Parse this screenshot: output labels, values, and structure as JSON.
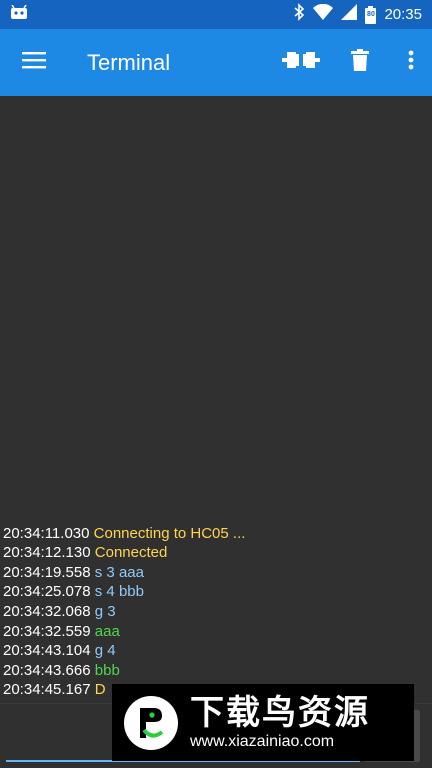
{
  "status_bar": {
    "time": "20:35",
    "battery_level": "80",
    "icons": [
      "android-icon",
      "bluetooth-icon",
      "wifi-icon",
      "cell-signal-icon",
      "battery-icon"
    ]
  },
  "app_bar": {
    "title": "Terminal",
    "actions": [
      "connect-icon",
      "delete-icon",
      "more-vert-icon"
    ]
  },
  "terminal": {
    "lines": [
      {
        "time": "20:34:11.030",
        "text": "Connecting to HC05 ...",
        "kind": "status"
      },
      {
        "time": "20:34:12.130",
        "text": "Connected",
        "kind": "status"
      },
      {
        "time": "20:34:19.558",
        "text": "s 3 aaa",
        "kind": "sent"
      },
      {
        "time": "20:34:25.078",
        "text": "s 4 bbb",
        "kind": "sent"
      },
      {
        "time": "20:34:32.068",
        "text": "g 3",
        "kind": "sent"
      },
      {
        "time": "20:34:32.559",
        "text": "aaa",
        "kind": "received"
      },
      {
        "time": "20:34:43.104",
        "text": "g 4",
        "kind": "sent"
      },
      {
        "time": "20:34:43.666",
        "text": "bbb",
        "kind": "received"
      },
      {
        "time": "20:34:45.167",
        "text": "D",
        "kind": "status"
      }
    ]
  },
  "send_bar": {
    "input_value": ""
  },
  "watermark": {
    "title": "下载鸟资源",
    "url": "www.xiazainiao.com"
  },
  "colors": {
    "status_bar": "#1565c0",
    "app_bar": "#1e88e5",
    "background": "#303030",
    "status_text": "#ffd54f",
    "sent_text": "#90caf9",
    "received_text": "#4cd84c"
  }
}
